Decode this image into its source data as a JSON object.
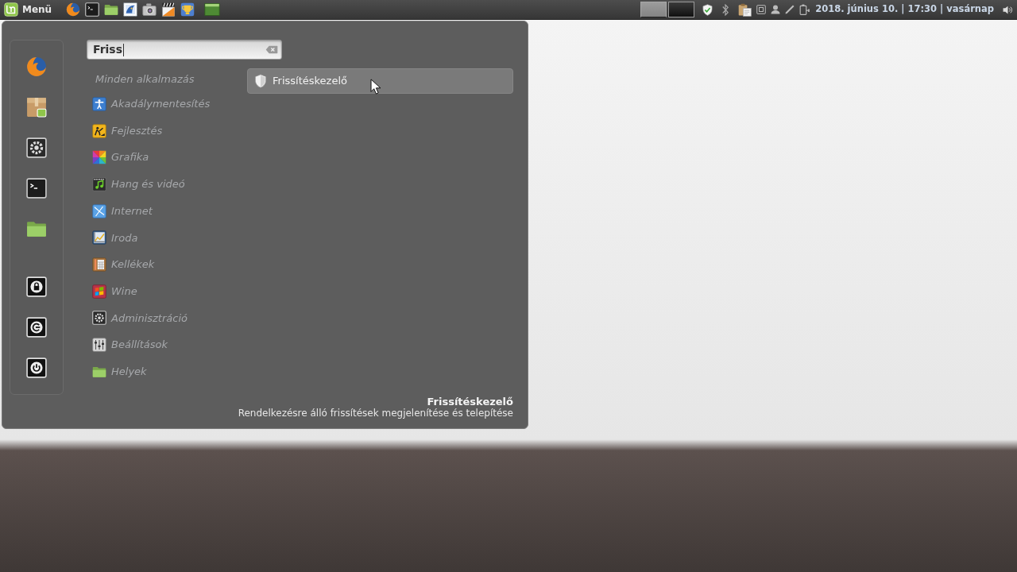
{
  "panel": {
    "menu_label": "Menü",
    "workspaces": [
      {
        "selected": true
      },
      {
        "selected": false
      }
    ],
    "clock": "2018. június 10. | 17:30 | vasárnap"
  },
  "menu": {
    "search": {
      "value": "Friss"
    },
    "all_applications": "Minden alkalmazás",
    "categories": [
      "Akadálymentesítés",
      "Fejlesztés",
      "Grafika",
      "Hang és videó",
      "Internet",
      "Iroda",
      "Kellékek",
      "Wine",
      "Adminisztráció",
      "Beállítások",
      "Helyek"
    ],
    "results": [
      {
        "label": "Frissítéskezelő",
        "selected": true
      }
    ],
    "description": {
      "title": "Frissítéskezelő",
      "text": "Rendelkezésre álló frissítések megjelenítése és telepítése"
    }
  }
}
